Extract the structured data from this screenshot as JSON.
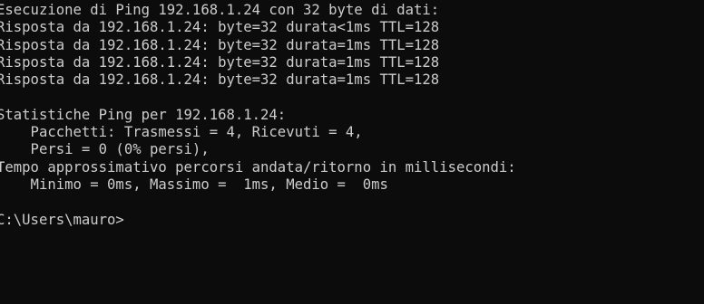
{
  "console": {
    "lines": [
      "Esecuzione di Ping 192.168.1.24 con 32 byte di dati:",
      "Risposta da 192.168.1.24: byte=32 durata<1ms TTL=128",
      "Risposta da 192.168.1.24: byte=32 durata=1ms TTL=128",
      "Risposta da 192.168.1.24: byte=32 durata=1ms TTL=128",
      "Risposta da 192.168.1.24: byte=32 durata=1ms TTL=128",
      "",
      "Statistiche Ping per 192.168.1.24:",
      "    Pacchetti: Trasmessi = 4, Ricevuti = 4,",
      "    Persi = 0 (0% persi),",
      "Tempo approssimativo percorsi andata/ritorno in millisecondi:",
      "    Minimo = 0ms, Massimo =  1ms, Medio =  0ms",
      "",
      "C:\\Users\\mauro>"
    ],
    "background": "#0c0c0c",
    "foreground": "#cccccc"
  }
}
